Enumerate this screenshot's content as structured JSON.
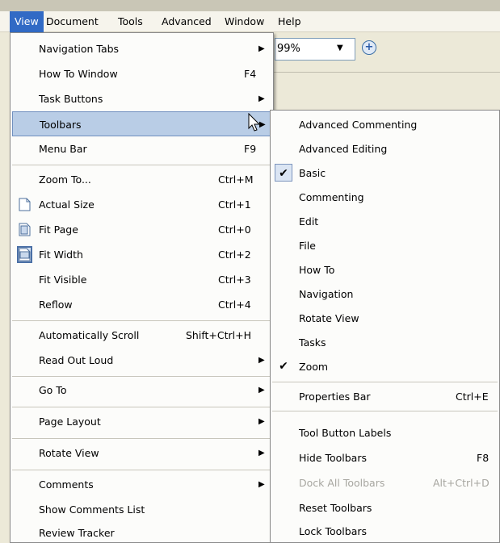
{
  "menubar": [
    {
      "label": "View",
      "active": true
    },
    {
      "label": "Document"
    },
    {
      "label": "Tools"
    },
    {
      "label": "Advanced"
    },
    {
      "label": "Window"
    },
    {
      "label": "Help"
    }
  ],
  "toolbar": {
    "zoom_value": "99%"
  },
  "view_menu": [
    {
      "label": "Navigation Tabs",
      "submenu": true
    },
    {
      "label": "How To Window",
      "shortcut": "F4"
    },
    {
      "label": "Task Buttons",
      "submenu": true
    },
    {
      "label": "Toolbars",
      "submenu": true,
      "highlight": true
    },
    {
      "label": "Menu Bar",
      "shortcut": "F9"
    },
    {
      "label": "Zoom To...",
      "shortcut": "Ctrl+M"
    },
    {
      "label": "Actual Size",
      "shortcut": "Ctrl+1",
      "icon": "page-icon"
    },
    {
      "label": "Fit Page",
      "shortcut": "Ctrl+0",
      "icon": "fit-page-icon"
    },
    {
      "label": "Fit Width",
      "shortcut": "Ctrl+2",
      "icon": "fit-width-icon"
    },
    {
      "label": "Fit Visible",
      "shortcut": "Ctrl+3"
    },
    {
      "label": "Reflow",
      "shortcut": "Ctrl+4"
    },
    {
      "label": "Automatically Scroll",
      "shortcut": "Shift+Ctrl+H"
    },
    {
      "label": "Read Out Loud",
      "submenu": true
    },
    {
      "label": "Go To",
      "submenu": true
    },
    {
      "label": "Page Layout",
      "submenu": true
    },
    {
      "label": "Rotate View",
      "submenu": true
    },
    {
      "label": "Comments",
      "submenu": true
    },
    {
      "label": "Show Comments List"
    },
    {
      "label": "Review Tracker"
    }
  ],
  "toolbars_menu": [
    {
      "label": "Advanced Commenting"
    },
    {
      "label": "Advanced Editing"
    },
    {
      "label": "Basic",
      "checked": true
    },
    {
      "label": "Commenting"
    },
    {
      "label": "Edit"
    },
    {
      "label": "File"
    },
    {
      "label": "How To"
    },
    {
      "label": "Navigation"
    },
    {
      "label": "Rotate View"
    },
    {
      "label": "Tasks"
    },
    {
      "label": "Zoom",
      "checked": true
    },
    {
      "label": "Properties Bar",
      "shortcut": "Ctrl+E"
    },
    {
      "label": "Tool Button Labels"
    },
    {
      "label": "Hide Toolbars",
      "shortcut": "F8"
    },
    {
      "label": "Dock All Toolbars",
      "shortcut": "Alt+Ctrl+D",
      "disabled": true
    },
    {
      "label": "Reset Toolbars"
    },
    {
      "label": "Lock Toolbars"
    }
  ],
  "colors": {
    "menubar_active": "#316ac5",
    "highlight": "#b9cde6",
    "disabled_text": "#a7a6a0"
  }
}
